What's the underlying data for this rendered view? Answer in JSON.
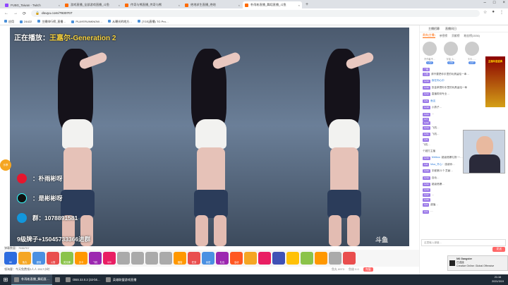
{
  "browser": {
    "tabs": [
      {
        "label": "PUBG_Taiwan - Twitch",
        "color": "#9146ff"
      },
      {
        "label": "游戏直播_全部游戏直播_斗鱼",
        "color": "#ff6a00"
      },
      {
        "label": "传奇与熊直播_传奇与熊",
        "color": "#ff6a00"
      },
      {
        "label": "绝地求生直播_绝地",
        "color": "#ff6a00"
      },
      {
        "label": "朴雨彬直播_舞蹈直播_斗鱼",
        "color": "#ff6a00"
      }
    ],
    "active_tab": 4,
    "new_tab": "+",
    "url": "douyu.com/7930707",
    "bookmarks": [
      "应用",
      "24422",
      "主播排行榜_直播…",
      "PLAYERUNKNOW…",
      "从曝光的地方…",
      "[TGS]直播) TG Pro…"
    ]
  },
  "video": {
    "now_playing_label": "正在播放：",
    "now_playing_song": "王嘉尔-Generation 2",
    "social": [
      {
        "icon": "weibo-icon",
        "text": "：朴雨彬呀"
      },
      {
        "icon": "douyin-icon",
        "text": "：是彬彬呀"
      },
      {
        "icon": "qq-icon",
        "text": "群：1078891581"
      }
    ],
    "fans": "9级牌子+15045733366进群",
    "side_badge": "乐享",
    "watermark": "斗鱼",
    "stats": "弹幕数量：7930707"
  },
  "gifts": [
    {
      "label": "8K",
      "color": "#2d6cdf"
    },
    {
      "label": "鱼丸",
      "color": "#f5a623"
    },
    {
      "label": "超值",
      "color": "#4a90e2"
    },
    {
      "label": "火箭",
      "color": "#e94e4e"
    },
    {
      "label": "荧光棒",
      "color": "#8bc34a"
    },
    {
      "label": "办卡",
      "color": "#ff9800"
    },
    {
      "label": "飞机",
      "color": "#9c27b0"
    },
    {
      "label": "520",
      "color": "#e91e63"
    },
    {
      "label": "",
      "color": "#aaa"
    },
    {
      "label": "",
      "color": "#aaa"
    },
    {
      "label": "",
      "color": "#aaa"
    },
    {
      "label": "",
      "color": "#aaa"
    },
    {
      "label": "福袋",
      "color": "#ff9800"
    },
    {
      "label": "任务",
      "color": "#e94e4e"
    },
    {
      "label": "亲密",
      "color": "#4a90e2"
    },
    {
      "label": "礼包",
      "color": "#9c27b0"
    },
    {
      "label": "活动",
      "color": "#ff5722"
    },
    {
      "label": "",
      "color": "#f5a623"
    },
    {
      "label": "",
      "color": "#e91e63"
    },
    {
      "label": "",
      "color": "#3f51b5"
    },
    {
      "label": "",
      "color": "#ffc107"
    },
    {
      "label": "",
      "color": "#8bc34a"
    },
    {
      "label": "",
      "color": "#ff9800"
    },
    {
      "label": "",
      "color": "#aaa"
    },
    {
      "label": "",
      "color": "#e94e4e"
    }
  ],
  "sub_line": "领淘客：今天免费领2人人 2017小时",
  "balance": {
    "fish": "鱼丸 8973",
    "gold": "鱼翅 0.0",
    "charge": "充值"
  },
  "sidebar": {
    "top": [
      "主播招募",
      "直播间日"
    ],
    "tabs": [
      "贵宾(主播)",
      "亲密榜",
      "贡献榜",
      "粉丝榜(1536)"
    ],
    "active_tab": 0,
    "ranks": [
      {
        "name": "不作者不…",
        "level": "LV2"
      },
      {
        "name": "宇宙_3…",
        "level": "LV5"
      },
      {
        "name": "卡卡……",
        "level": "LV7"
      }
    ],
    "promo": "主播年度盛典",
    "chat": [
      {
        "badge": "一般",
        "name": "",
        "text": ""
      },
      {
        "badge": "公告",
        "name": "",
        "text": "请不要把你手里的玩具留给一辈…"
      },
      {
        "badge": "LV16",
        "name": "我在你心中",
        "text": ""
      },
      {
        "badge": "LV30",
        "name": "",
        "text": "张金荣把你手里的玩具留给一辈"
      },
      {
        "badge": "LV12",
        "name": "",
        "text": "直播带到专业…"
      },
      {
        "badge": "LV9",
        "name": "鱼友",
        "text": ""
      },
      {
        "badge": "LV18",
        "name": "",
        "text": "小燕子…"
      },
      {
        "badge": "LV24",
        "name": "",
        "text": "…"
      },
      {
        "badge": "LV7",
        "name": "",
        "text": ""
      },
      {
        "badge": "LV22",
        "name": "",
        "text": ""
      },
      {
        "badge": "LV14",
        "name": "",
        "text": "飞机…"
      },
      {
        "badge": "LV31",
        "name": "",
        "text": "飞机…"
      },
      {
        "badge": "LV5",
        "name": "",
        "text": ""
      },
      {
        "badge": "",
        "name": "",
        "text": "飞机…"
      },
      {
        "badge": "",
        "name": "",
        "text": "个超打主播"
      },
      {
        "badge": "LV15",
        "name": "Mrtibou",
        "text": "超级燃爆礼物·一…"
      },
      {
        "badge": "LV8",
        "name": "Mua_开心~",
        "text": "感谢你…"
      },
      {
        "badge": "LV20",
        "name": "",
        "text": "宇都第21个 贡献…"
      },
      {
        "badge": "LV10",
        "name": "",
        "text": "自动…"
      },
      {
        "badge": "LV33",
        "name": "",
        "text": "超级燃爆…"
      },
      {
        "badge": "LV19",
        "name": "",
        "text": ""
      },
      {
        "badge": "LV17",
        "name": "",
        "text": "…"
      },
      {
        "badge": "LV26",
        "name": "",
        "text": ""
      },
      {
        "badge": "LV4",
        "name": "",
        "text": "超值…"
      },
      {
        "badge": "LV1",
        "name": "",
        "text": "…"
      }
    ],
    "chat_placeholder": "这里输入弹幕…",
    "send": "发送"
  },
  "notification": {
    "title": "NK Gangster",
    "line1": "已连接",
    "line2": "Creative Online: Global Offensive"
  },
  "taskbar": {
    "items": [
      {
        "label": "朴雨彬直播_舞蹈直…",
        "active": true
      },
      {
        "label": "",
        "active": false
      },
      {
        "label": "OBS 22.0.2 (32-bit…",
        "active": false
      },
      {
        "label": "英雄联盟游戏直播",
        "active": false
      }
    ],
    "time": "21:16",
    "date": "2021/3/19"
  }
}
